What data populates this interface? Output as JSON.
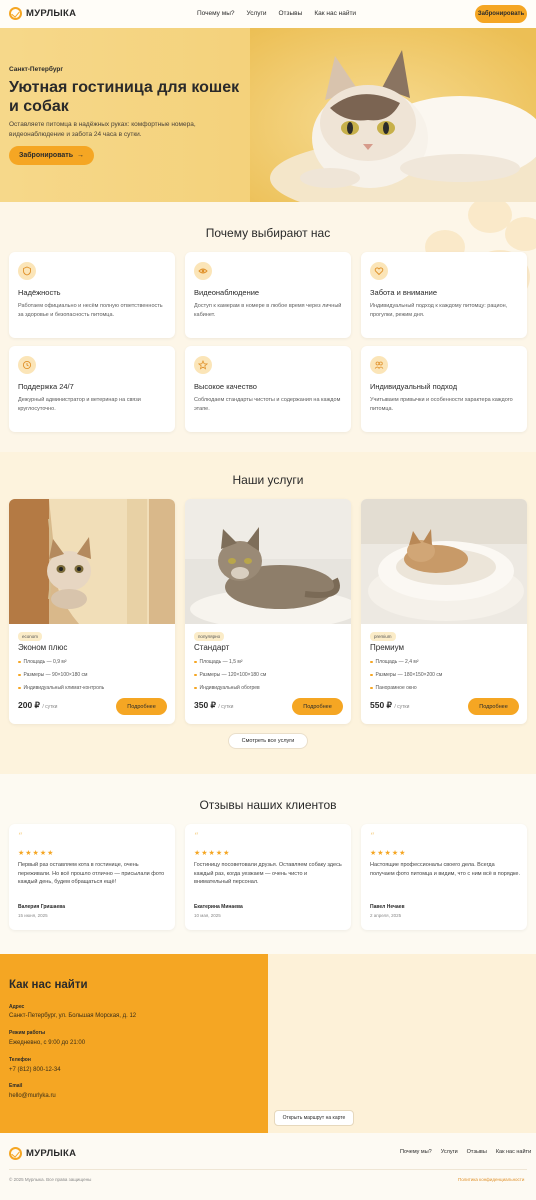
{
  "header": {
    "logo": "МУРЛЫКА",
    "nav": [
      "Почему мы?",
      "Услуги",
      "Отзывы",
      "Как нас найти"
    ],
    "cta": "Забронировать"
  },
  "hero": {
    "city": "Санкт-Петербург",
    "title": "Уютная гостиница для кошек и собак",
    "description": "Оставляете питомца в надёжных руках: комфортные номера, видеонаблюдение и забота 24 часа в сутки.",
    "cta": "Забронировать"
  },
  "why": {
    "title": "Почему выбирают нас",
    "items": [
      {
        "icon": "shield-icon",
        "title": "Надёжность",
        "text": "Работаем официально и несём полную ответственность за здоровье и безопасность питомца."
      },
      {
        "icon": "eye-icon",
        "title": "Видеонаблюдение",
        "text": "Доступ к камерам в номере в любое время через личный кабинет."
      },
      {
        "icon": "heart-icon",
        "title": "Забота и внимание",
        "text": "Индивидуальный подход к каждому питомцу: рацион, прогулки, режим дня."
      },
      {
        "icon": "clock-icon",
        "title": "Поддержка 24/7",
        "text": "Дежурный администратор и ветеринар на связи круглосуточно."
      },
      {
        "icon": "star-icon",
        "title": "Высокое качество",
        "text": "Соблюдаем стандарты чистоты и содержания на каждом этапе."
      },
      {
        "icon": "people-icon",
        "title": "Индивидуальный подход",
        "text": "Учитываем привычки и особенности характера каждого питомца."
      }
    ]
  },
  "services": {
    "title": "Наши услуги",
    "items": [
      {
        "badge": "econom",
        "name": "Эконом плюс",
        "features": [
          "Площадь — 0,9 м²",
          "Размеры — 90×100×180 см",
          "Индивидуальный климат-контроль"
        ],
        "price": "200 ₽",
        "per": "/ сутки",
        "cta": "Подробнее"
      },
      {
        "badge": "популярно",
        "name": "Стандарт",
        "features": [
          "Площадь — 1,5 м²",
          "Размеры — 120×100×180 см",
          "Индивидуальный обогрев"
        ],
        "price": "350 ₽",
        "per": "/ сутки",
        "cta": "Подробнее"
      },
      {
        "badge": "premium",
        "name": "Премиум",
        "features": [
          "Площадь — 2,4 м²",
          "Размеры — 180×150×200 см",
          "Панорамное окно"
        ],
        "price": "550 ₽",
        "per": "/ сутки",
        "cta": "Подробнее"
      }
    ],
    "all": "Смотреть все услуги"
  },
  "reviews": {
    "title": "Отзывы наших клиентов",
    "items": [
      {
        "stars": "★★★★★",
        "text": "Первый раз оставляем кота в гостинице, очень переживали. Но всё прошло отлично — присылали фото каждый день, будем обращаться ещё!",
        "author": "Валерия Гришаева",
        "date": "15 июня, 2025"
      },
      {
        "stars": "★★★★★",
        "text": "Гостиницу посоветовали друзья. Оставляем собаку здесь каждый раз, когда уезжаем — очень чисто и внимательный персонал.",
        "author": "Екатерина Минаева",
        "date": "10 мая, 2025"
      },
      {
        "stars": "★★★★★",
        "text": "Настоящие профессионалы своего дела. Всегда получаем фото питомца и видим, что с ним всё в порядке.",
        "author": "Павел Нечаев",
        "date": "2 апреля, 2025"
      }
    ]
  },
  "contact": {
    "title": "Как нас найти",
    "address_label": "Адрес",
    "address": "Санкт-Петербург, ул. Большая Морская, д. 12",
    "hours_label": "Режим работы",
    "hours": "Ежедневно, с 9:00 до 21:00",
    "phone_label": "Телефон",
    "phone": "+7 (812) 800-12-34",
    "email_label": "Email",
    "email": "hello@murlyka.ru",
    "route": "Открыть маршрут на карте"
  },
  "footer": {
    "logo": "МУРЛЫКА",
    "nav": [
      "Почему мы?",
      "Услуги",
      "Отзывы",
      "Как нас найти"
    ],
    "copyright": "© 2025 Мурлыка. Все права защищены",
    "privacy": "Политика конфиденциальности"
  },
  "colors": {
    "accent": "#f5a623",
    "background": "#fdfaf3",
    "text": "#2b2b2b"
  }
}
